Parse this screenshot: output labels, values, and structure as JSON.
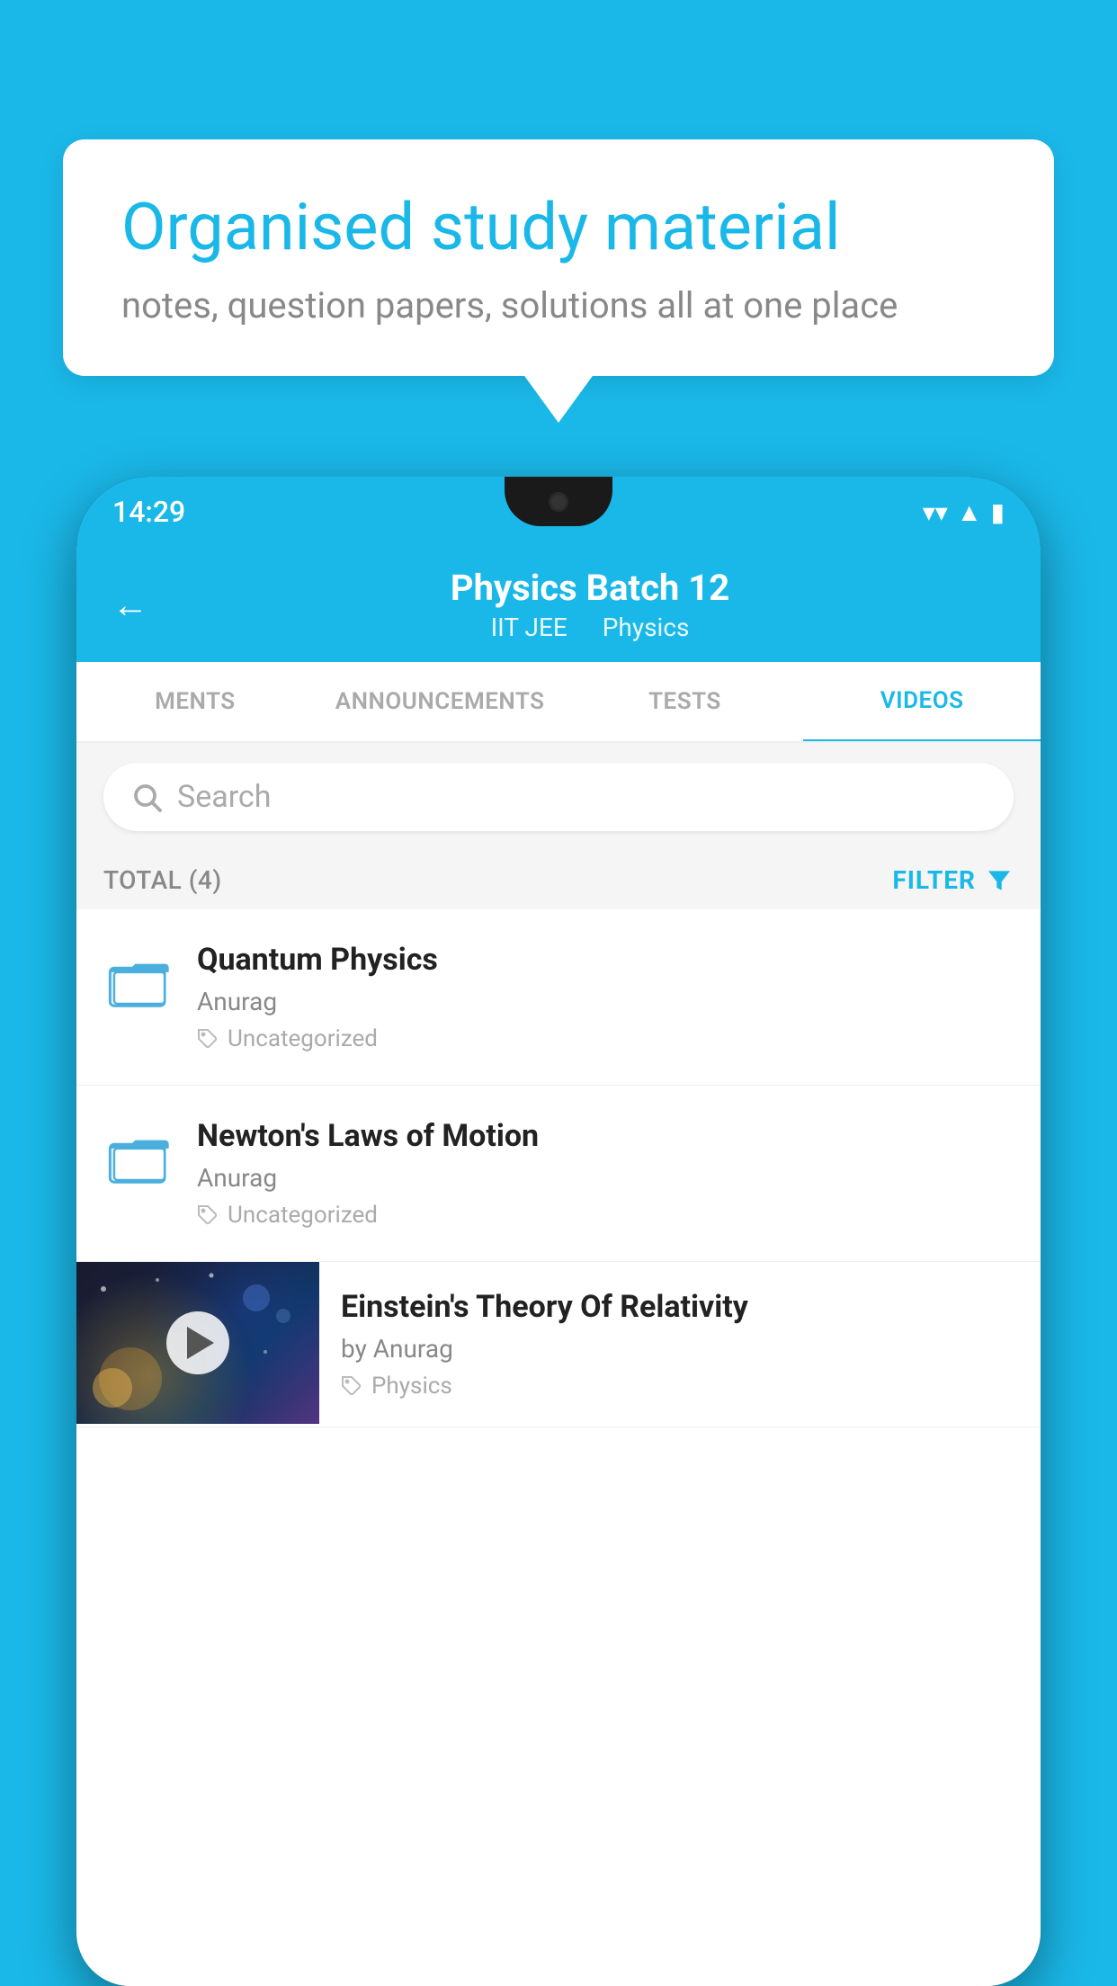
{
  "background": {
    "color": "#1ab8e8"
  },
  "speechBubble": {
    "title": "Organised study material",
    "subtitle": "notes, question papers, solutions all at one place"
  },
  "phone": {
    "statusBar": {
      "time": "14:29"
    },
    "header": {
      "title": "Physics Batch 12",
      "subtitle1": "IIT JEE",
      "subtitle2": "Physics",
      "backLabel": "←"
    },
    "tabs": [
      {
        "label": "MENTS",
        "active": false
      },
      {
        "label": "ANNOUNCEMENTS",
        "active": false
      },
      {
        "label": "TESTS",
        "active": false
      },
      {
        "label": "VIDEOS",
        "active": true
      }
    ],
    "search": {
      "placeholder": "Search"
    },
    "filterBar": {
      "totalLabel": "TOTAL (4)",
      "filterLabel": "FILTER"
    },
    "videos": [
      {
        "title": "Quantum Physics",
        "author": "Anurag",
        "tag": "Uncategorized",
        "hasMedia": false
      },
      {
        "title": "Newton's Laws of Motion",
        "author": "Anurag",
        "tag": "Uncategorized",
        "hasMedia": false
      },
      {
        "title": "Einstein's Theory Of Relativity",
        "author": "by Anurag",
        "tag": "Physics",
        "hasMedia": true
      }
    ]
  }
}
